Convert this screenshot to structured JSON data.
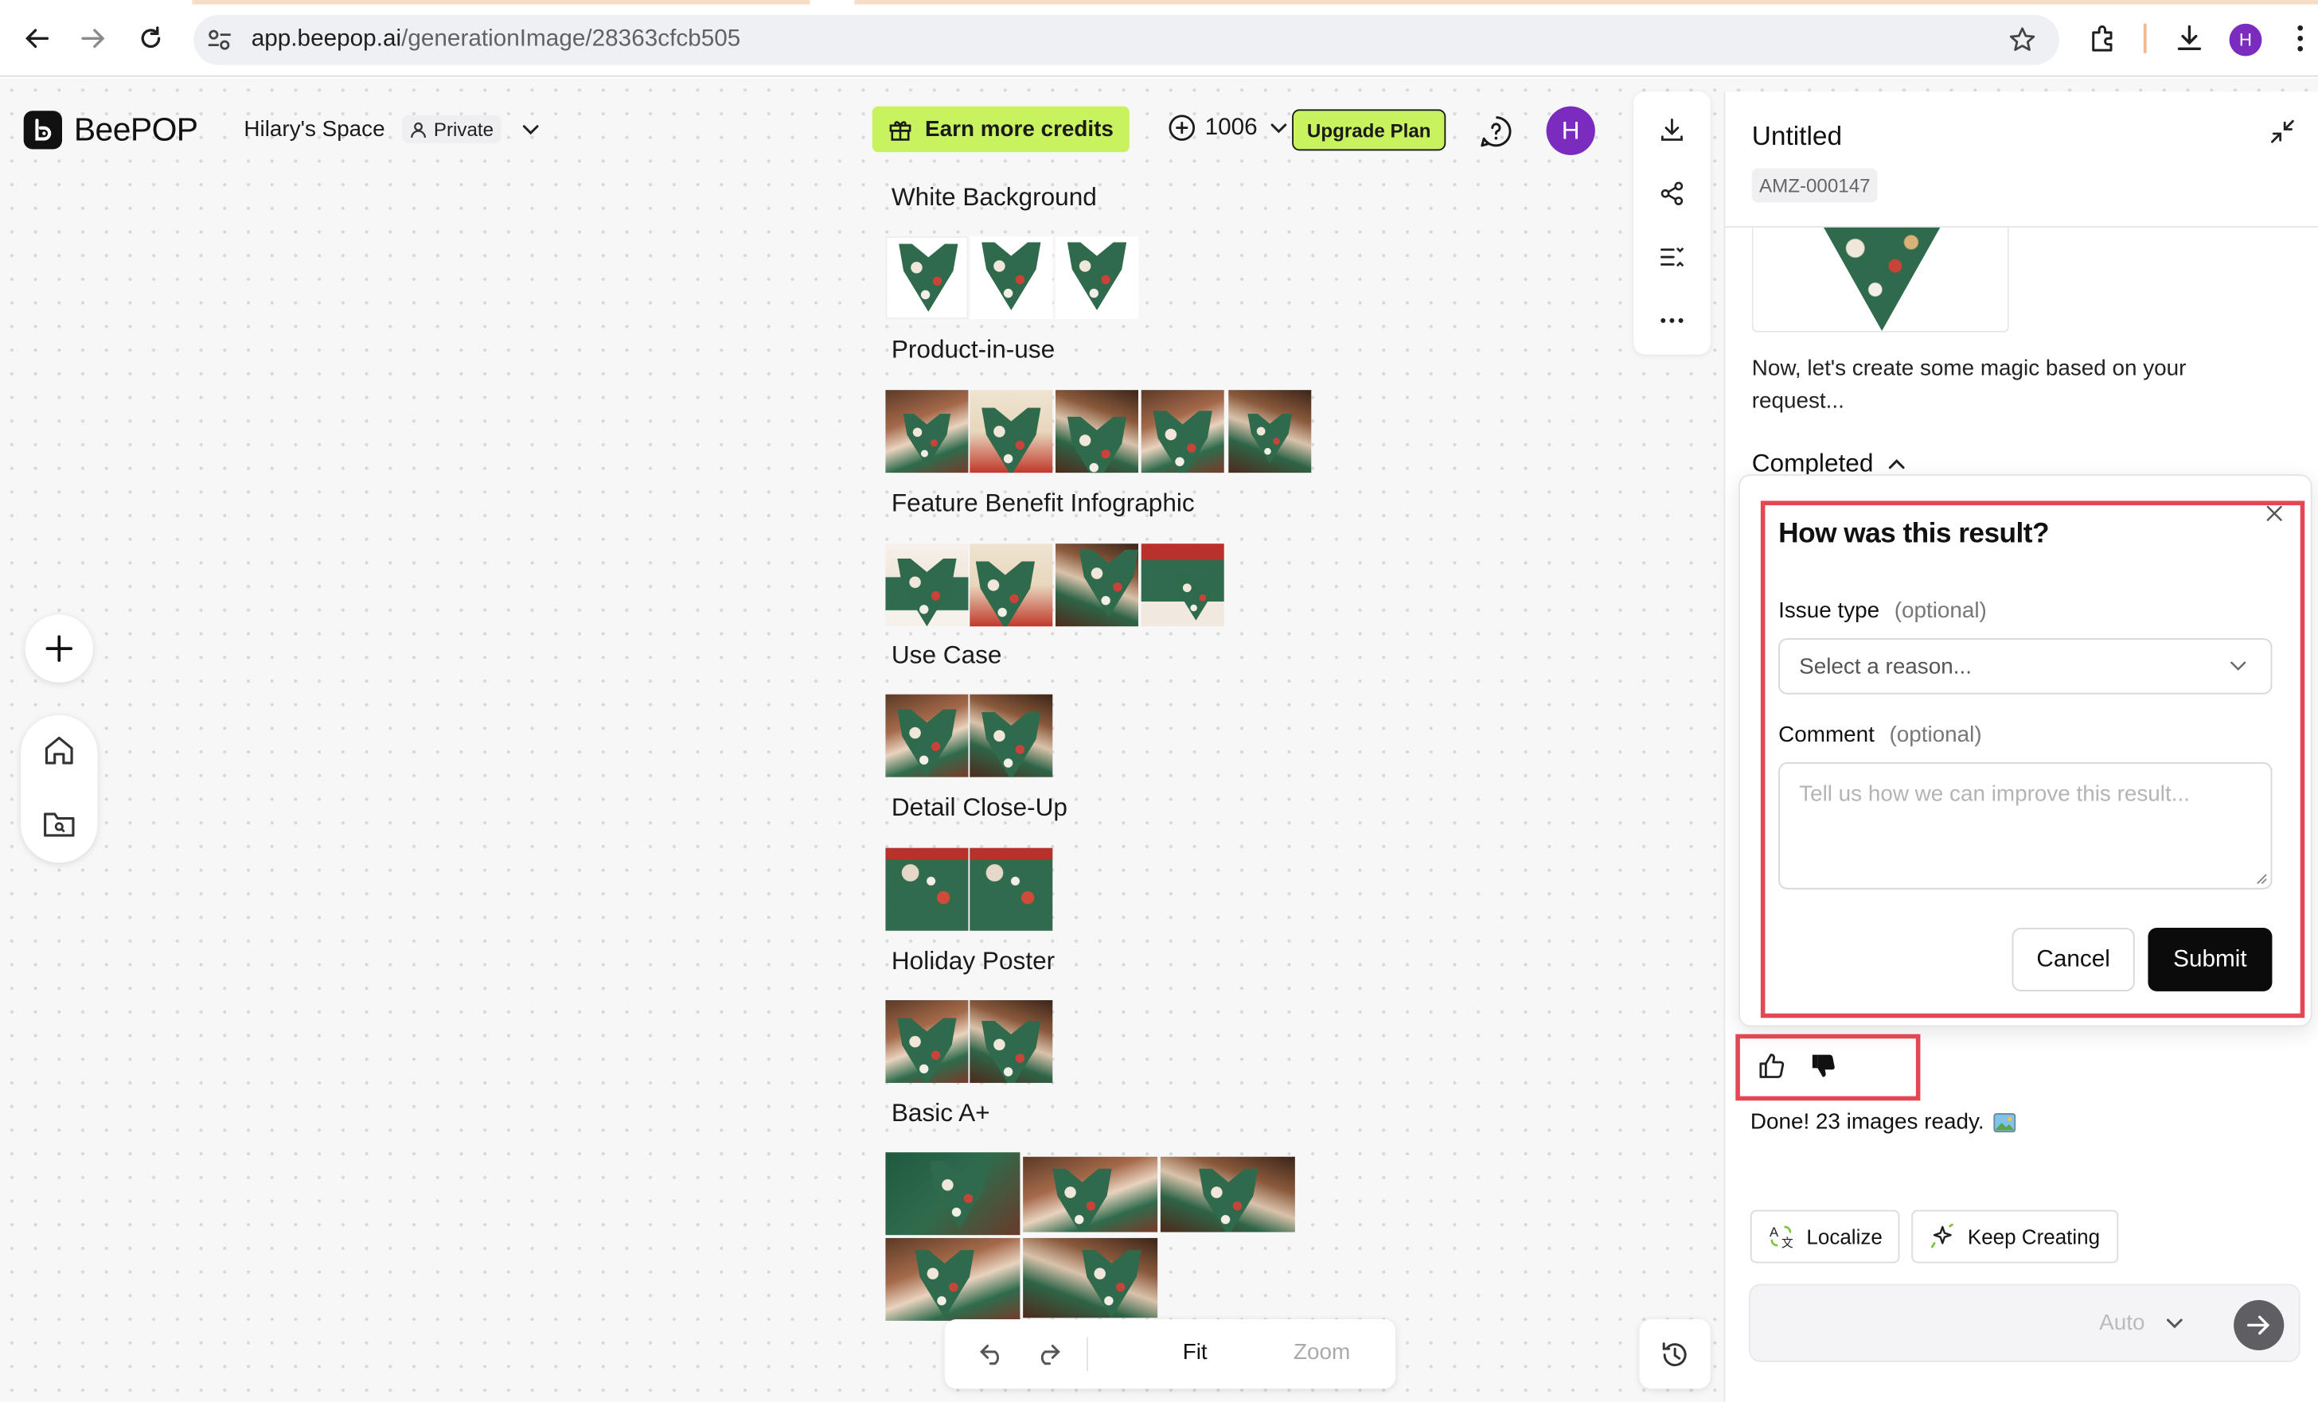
{
  "browser": {
    "url_domain": "app.beepop.ai",
    "url_path": "/generationImage/28363cfcb505",
    "profile_initial": "H"
  },
  "header": {
    "brand": "BeePOP",
    "space_name": "Hilary's Space",
    "visibility": "Private",
    "earn_credits": "Earn more credits",
    "credits": "1006",
    "upgrade": "Upgrade Plan",
    "avatar_initial": "H"
  },
  "canvas": {
    "sections": [
      {
        "title": "White Background",
        "count": 3
      },
      {
        "title": "Product-in-use",
        "count": 5
      },
      {
        "title": "Feature Benefit Infographic",
        "count": 4
      },
      {
        "title": "Use Case",
        "count": 2
      },
      {
        "title": "Detail Close-Up",
        "count": 2
      },
      {
        "title": "Holiday Poster",
        "count": 2
      },
      {
        "title": "Basic A+",
        "count": 5
      }
    ]
  },
  "bottom_toolbar": {
    "fit": "Fit",
    "zoom": "Zoom"
  },
  "panel": {
    "title": "Untitled",
    "id": "AMZ-000147",
    "message": "Now, let's create some magic based on your request...",
    "status": "Completed",
    "feedback": {
      "title": "How was this result?",
      "issue_label": "Issue type",
      "optional": "(optional)",
      "select_placeholder": "Select a reason...",
      "comment_label": "Comment",
      "comment_placeholder": "Tell us how we can improve this result...",
      "cancel": "Cancel",
      "submit": "Submit"
    },
    "done": "Done! 23 images ready.",
    "actions": {
      "localize": "Localize",
      "keep_creating": "Keep Creating"
    },
    "composer_mode": "Auto"
  },
  "colors": {
    "accent_green": "#c9f35e",
    "avatar_purple": "#7b2cbf",
    "highlight_red": "#e54654"
  }
}
